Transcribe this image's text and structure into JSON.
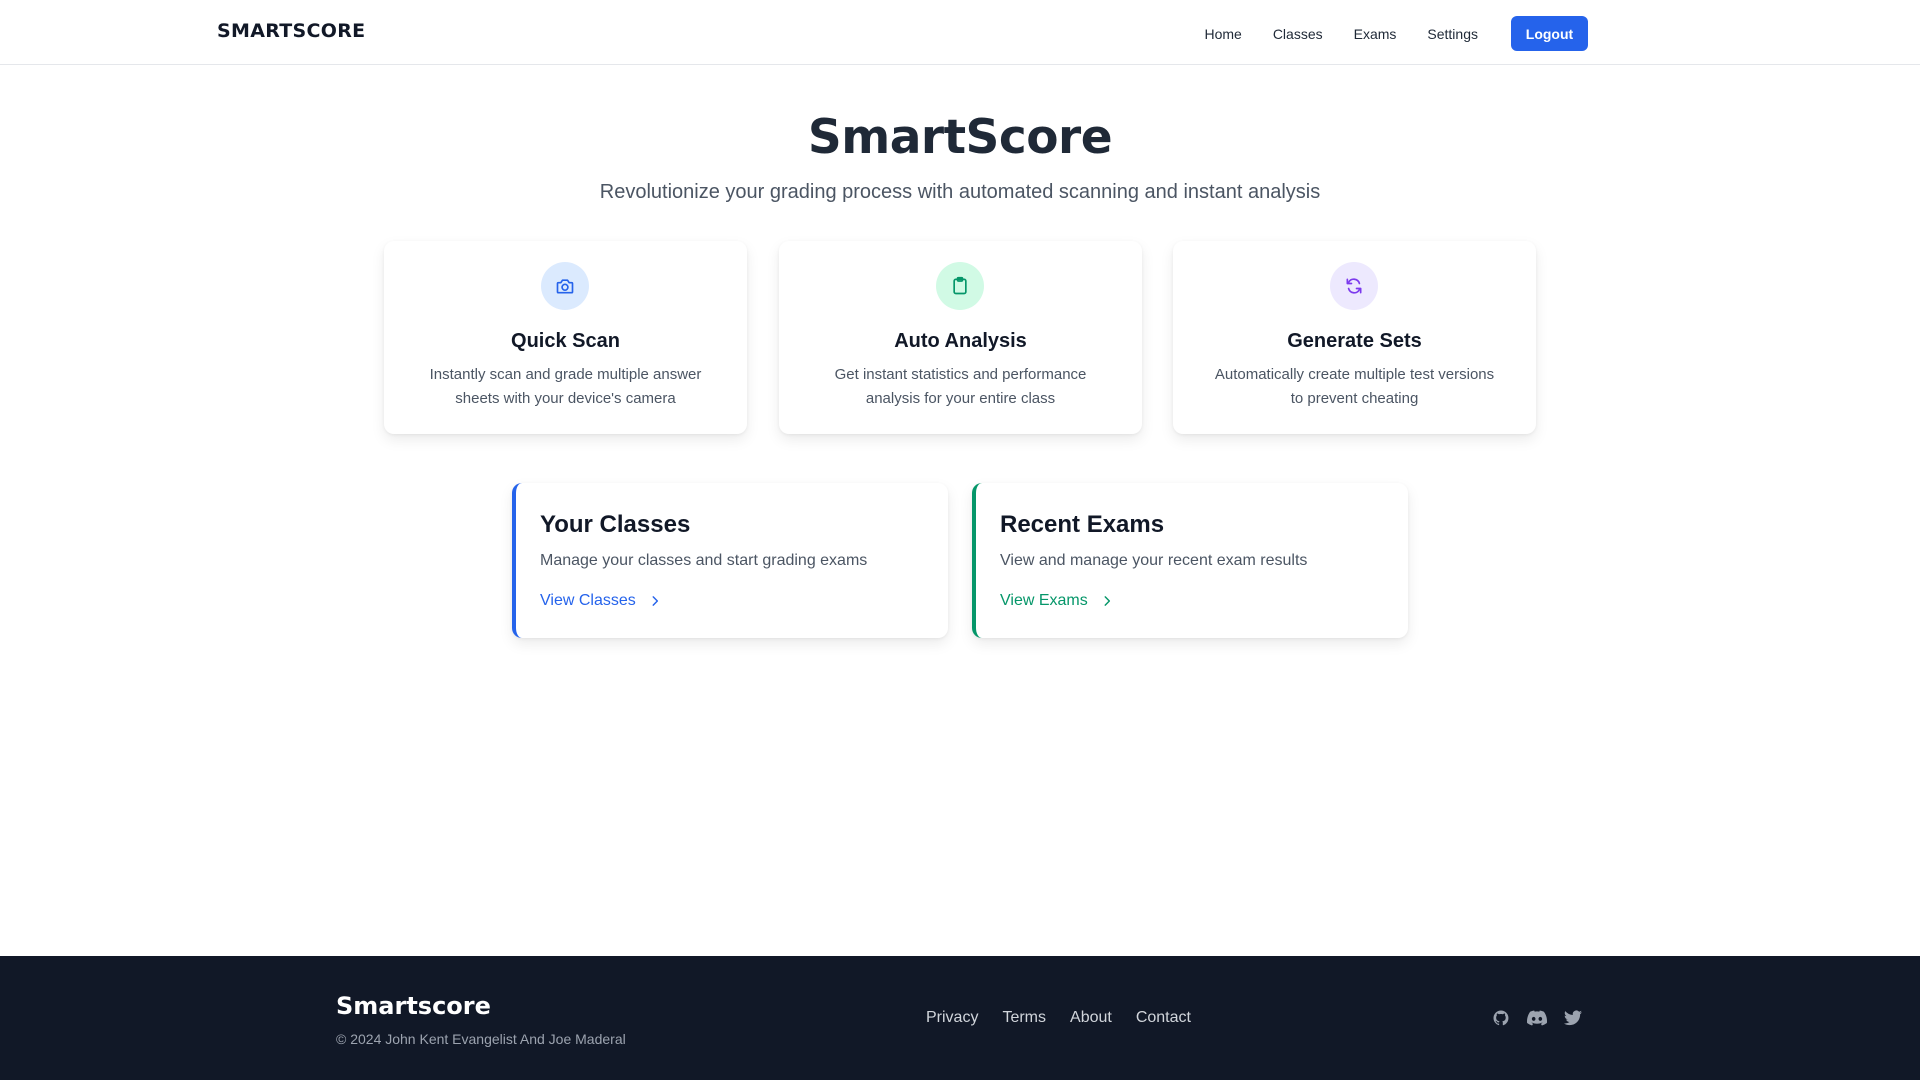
{
  "header": {
    "brand": "SMARTSCORE",
    "nav": [
      "Home",
      "Classes",
      "Exams",
      "Settings"
    ],
    "logout_label": "Logout",
    "accent": "#2563eb"
  },
  "hero": {
    "title": "SmartScore",
    "subtitle": "Revolutionize your grading process with automated scanning and instant analysis"
  },
  "features": [
    {
      "title": "Quick Scan",
      "line1": "Instantly scan and grade multiple answer",
      "line2": "sheets with your device's camera",
      "icon": "camera-icon",
      "icon_bg": "#dbeafe",
      "icon_color": "#2563eb"
    },
    {
      "title": "Auto Analysis",
      "line1": "Get instant statistics and performance",
      "line2": "analysis for your entire class",
      "icon": "clipboard-icon",
      "icon_bg": "#d1fae5",
      "icon_color": "#059669"
    },
    {
      "title": "Generate Sets",
      "line1": "Automatically create multiple test versions",
      "line2": "to prevent cheating",
      "icon": "refresh-icon",
      "icon_bg": "#ede9fe",
      "icon_color": "#7c3aed"
    }
  ],
  "cards": [
    {
      "title": "Your Classes",
      "description": "Manage your classes and start grading exams",
      "link": "View Classes",
      "accent": "#2563eb"
    },
    {
      "title": "Recent Exams",
      "description": "View and manage your recent exam results",
      "link": "View Exams",
      "accent": "#059669"
    }
  ],
  "footer": {
    "brand": "Smartscore",
    "copyright": "© 2024 John Kent Evangelist And Joe Maderal",
    "links": [
      "Privacy",
      "Terms",
      "About",
      "Contact"
    ],
    "icons": [
      "github-icon",
      "discord-icon",
      "twitter-icon"
    ]
  }
}
